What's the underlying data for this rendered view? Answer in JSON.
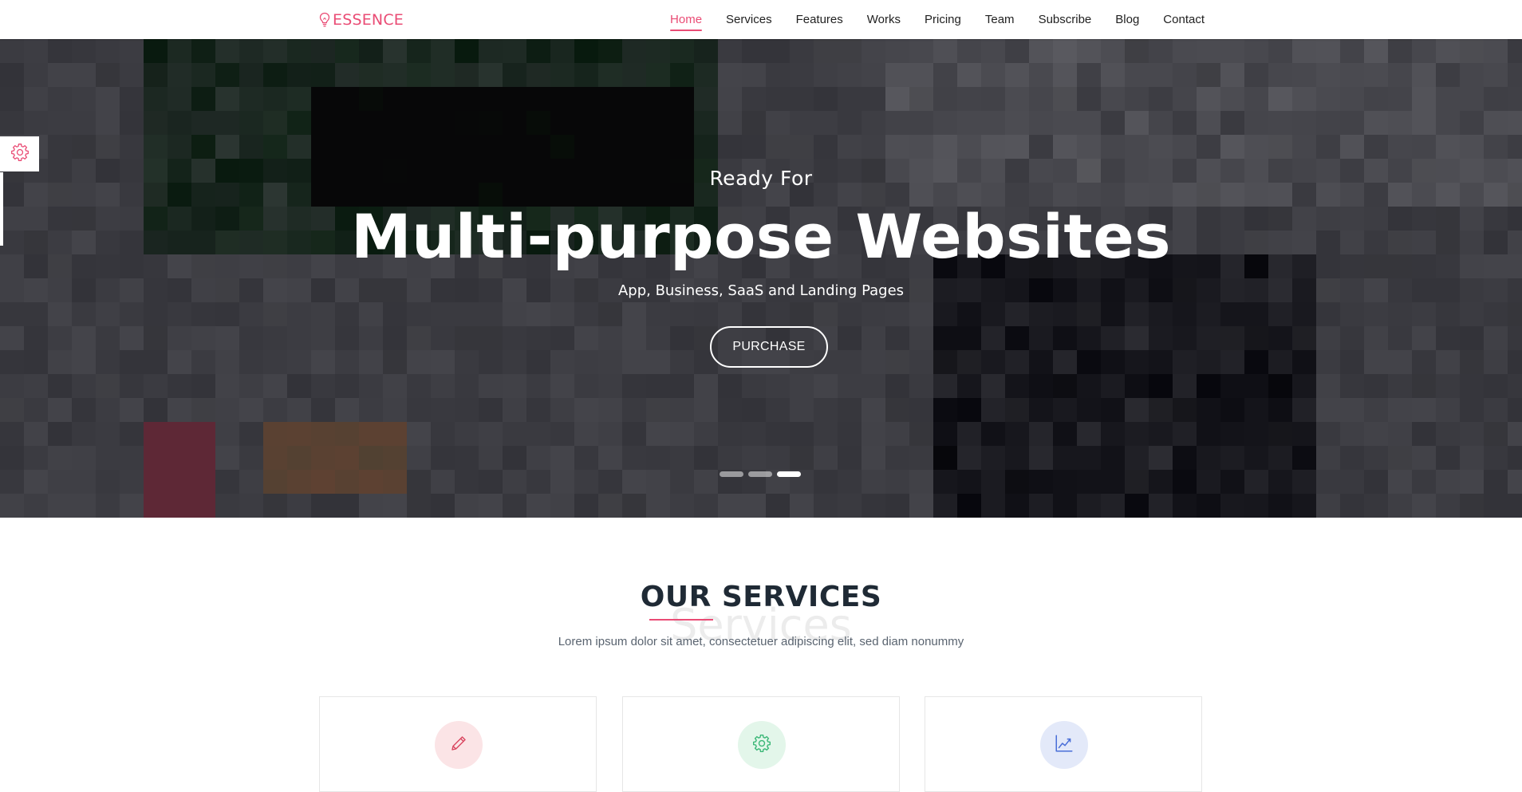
{
  "brand": {
    "name": "ESSENCE",
    "icon": "lightbulb-icon",
    "color": "#ea4c75"
  },
  "nav": {
    "items": [
      {
        "label": "Home",
        "active": true
      },
      {
        "label": "Services"
      },
      {
        "label": "Features"
      },
      {
        "label": "Works"
      },
      {
        "label": "Pricing"
      },
      {
        "label": "Team"
      },
      {
        "label": "Subscribe"
      },
      {
        "label": "Blog"
      },
      {
        "label": "Contact"
      }
    ]
  },
  "hero": {
    "kicker": "Ready For",
    "title": "Multi-purpose Websites",
    "subtitle": "App, Business, SaaS and Landing Pages",
    "button_label": "PURCHASE",
    "slides_count": 3,
    "active_slide": 3
  },
  "settings": {
    "icon": "gear-icon"
  },
  "services": {
    "title": "OUR SERVICES",
    "watermark": "Services",
    "description": "Lorem ipsum dolor sit amet, consectetuer adipiscing elit, sed diam nonummy",
    "cards": [
      {
        "icon": "pencil-icon",
        "icon_color": "#d9455f",
        "icon_bg": "#fbe4e6"
      },
      {
        "icon": "gear-icon",
        "icon_color": "#3cb878",
        "icon_bg": "#e3f6ea"
      },
      {
        "icon": "chart-line-icon",
        "icon_color": "#4a6fd8",
        "icon_bg": "#e3e9f9"
      }
    ]
  },
  "colors": {
    "accent": "#ea4c75",
    "heading": "#1f2a35",
    "text": "#5a6470"
  }
}
